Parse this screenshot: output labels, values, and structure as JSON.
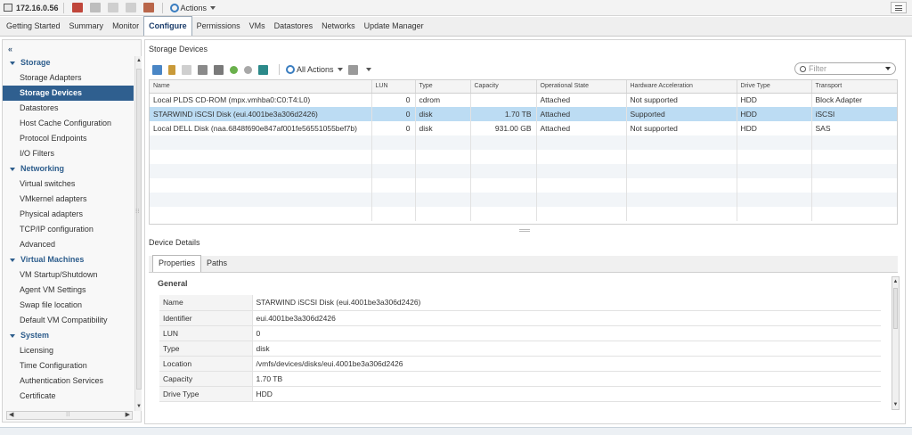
{
  "topbar": {
    "host": "172.16.0.56",
    "actions_label": "Actions"
  },
  "main_tabs": [
    "Getting Started",
    "Summary",
    "Monitor",
    "Configure",
    "Permissions",
    "VMs",
    "Datastores",
    "Networks",
    "Update Manager"
  ],
  "active_main_tab": "Configure",
  "sidebar": {
    "collapse": "«",
    "groups": [
      {
        "label": "Storage",
        "items": [
          "Storage Adapters",
          "Storage Devices",
          "Datastores",
          "Host Cache Configuration",
          "Protocol Endpoints",
          "I/O Filters"
        ]
      },
      {
        "label": "Networking",
        "items": [
          "Virtual switches",
          "VMkernel adapters",
          "Physical adapters",
          "TCP/IP configuration",
          "Advanced"
        ]
      },
      {
        "label": "Virtual Machines",
        "items": [
          "VM Startup/Shutdown",
          "Agent VM Settings",
          "Swap file location",
          "Default VM Compatibility"
        ]
      },
      {
        "label": "System",
        "items": [
          "Licensing",
          "Time Configuration",
          "Authentication Services",
          "Certificate"
        ]
      }
    ],
    "selected": "Storage Devices"
  },
  "panel": {
    "title": "Storage Devices",
    "toolbar_actions_label": "All Actions",
    "filter_placeholder": "Filter"
  },
  "table": {
    "columns": [
      "Name",
      "LUN",
      "Type",
      "Capacity",
      "Operational State",
      "Hardware Acceleration",
      "Drive Type",
      "Transport"
    ],
    "rows": [
      [
        "Local PLDS CD-ROM (mpx.vmhba0:C0:T4:L0)",
        "0",
        "cdrom",
        "",
        "Attached",
        "Not supported",
        "HDD",
        "Block Adapter"
      ],
      [
        "STARWIND iSCSI Disk (eui.4001be3a306d2426)",
        "0",
        "disk",
        "1.70 TB",
        "Attached",
        "Supported",
        "HDD",
        "iSCSI"
      ],
      [
        "Local DELL Disk (naa.6848f690e847af001fe56551055bef7b)",
        "0",
        "disk",
        "931.00 GB",
        "Attached",
        "Not supported",
        "HDD",
        "SAS"
      ]
    ],
    "selected_row": 1
  },
  "details": {
    "title": "Device Details",
    "tabs": [
      "Properties",
      "Paths"
    ],
    "section": "General",
    "props": [
      {
        "k": "Name",
        "v": "STARWIND iSCSI Disk (eui.4001be3a306d2426)"
      },
      {
        "k": "Identifier",
        "v": "eui.4001be3a306d2426"
      },
      {
        "k": "LUN",
        "v": "0"
      },
      {
        "k": "Type",
        "v": "disk"
      },
      {
        "k": "Location",
        "v": "/vmfs/devices/disks/eui.4001be3a306d2426"
      },
      {
        "k": "Capacity",
        "v": "1.70 TB"
      },
      {
        "k": "Drive Type",
        "v": "HDD"
      }
    ]
  }
}
